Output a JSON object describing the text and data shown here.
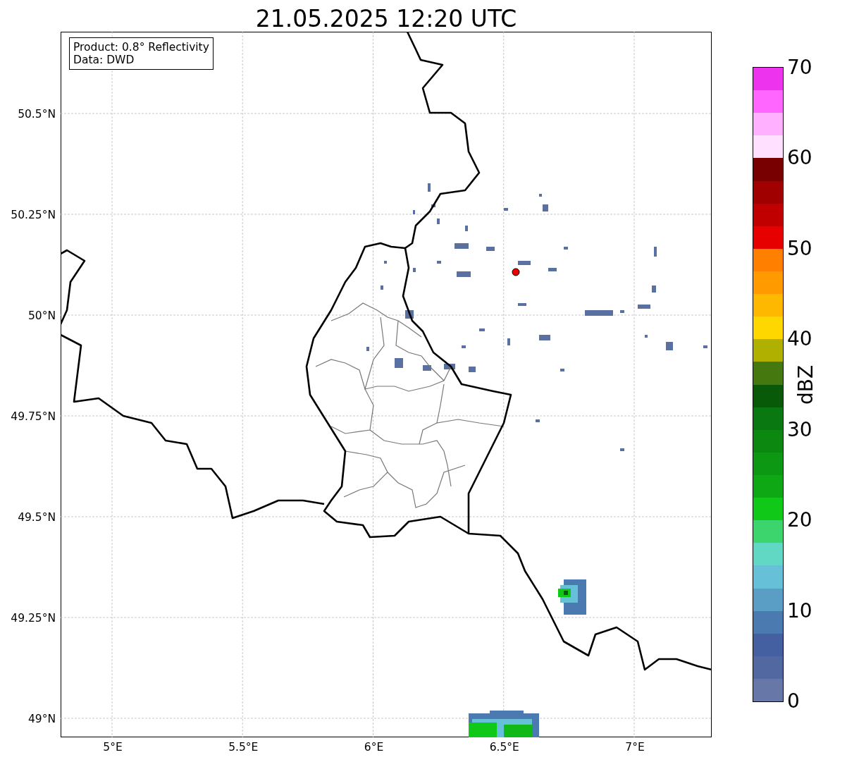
{
  "title": "21.05.2025 12:20 UTC",
  "legend": {
    "lines": [
      "Product: 0.8° Reflectivity",
      "Data: DWD"
    ]
  },
  "map": {
    "y_labels": [
      "50.5°N",
      "50.25°N",
      "50°N",
      "49.75°N",
      "49.5°N",
      "49.25°N",
      "49°N"
    ],
    "x_labels": [
      "5°E",
      "5.5°E",
      "6°E",
      "6.5°E",
      "7°E"
    ]
  },
  "colorbar": {
    "label": "dBZ",
    "tick_labels": [
      "70",
      "60",
      "50",
      "40",
      "30",
      "20",
      "10",
      "0"
    ],
    "bands": [
      {
        "color": "#ee33ee"
      },
      {
        "color": "#ff66ff"
      },
      {
        "color": "#ffb0ff"
      },
      {
        "color": "#ffe0ff"
      },
      {
        "color": "#780000"
      },
      {
        "color": "#a00000"
      },
      {
        "color": "#c00000"
      },
      {
        "color": "#e60000"
      },
      {
        "color": "#ff7f00"
      },
      {
        "color": "#ff9a00"
      },
      {
        "color": "#ffb800"
      },
      {
        "color": "#ffd700"
      },
      {
        "color": "#b0b000"
      },
      {
        "color": "#467810"
      },
      {
        "color": "#085a08"
      },
      {
        "color": "#0a7810"
      },
      {
        "color": "#0c8810"
      },
      {
        "color": "#0c9812"
      },
      {
        "color": "#0ea815"
      },
      {
        "color": "#10c818"
      },
      {
        "color": "#3cd46c"
      },
      {
        "color": "#60d8c4"
      },
      {
        "color": "#66c0d8"
      },
      {
        "color": "#5a9ec6"
      },
      {
        "color": "#4a7ab0"
      },
      {
        "color": "#4560a0"
      },
      {
        "color": "#5268a0"
      },
      {
        "color": "#6677a8"
      }
    ]
  }
}
